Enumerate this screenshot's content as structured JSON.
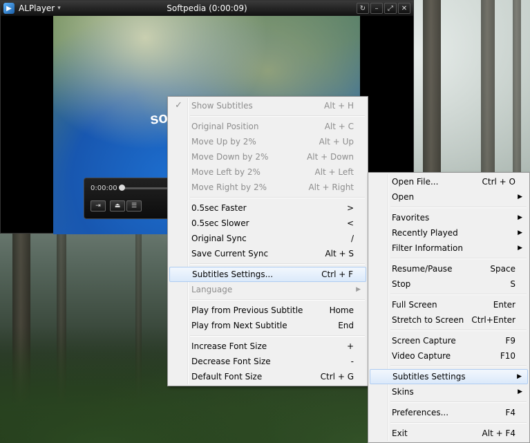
{
  "player": {
    "app_name": "ALPlayer",
    "window_title": "Softpedia (0:00:09)",
    "time": "0:00:00"
  },
  "subtitle_menu": {
    "items": [
      {
        "label": "Show Subtitles",
        "key": "Alt + H",
        "disabled": true,
        "checked": true
      },
      {
        "sep": true
      },
      {
        "label": "Original Position",
        "key": "Alt + C",
        "disabled": true
      },
      {
        "label": "Move Up by 2%",
        "key": "Alt + Up",
        "disabled": true
      },
      {
        "label": "Move Down by 2%",
        "key": "Alt + Down",
        "disabled": true
      },
      {
        "label": "Move Left by 2%",
        "key": "Alt + Left",
        "disabled": true
      },
      {
        "label": "Move Right by 2%",
        "key": "Alt + Right",
        "disabled": true
      },
      {
        "sep": true
      },
      {
        "label": "0.5sec Faster",
        "key": ">"
      },
      {
        "label": "0.5sec Slower",
        "key": "<"
      },
      {
        "label": "Original Sync",
        "key": "/"
      },
      {
        "label": "Save Current Sync",
        "key": "Alt + S"
      },
      {
        "sep": true
      },
      {
        "label": "Subtitles Settings...",
        "key": "Ctrl + F",
        "highlight": true
      },
      {
        "label": "Language",
        "disabled": true,
        "submenu": true
      },
      {
        "sep": true
      },
      {
        "label": "Play from Previous Subtitle",
        "key": "Home"
      },
      {
        "label": "Play from Next Subtitle",
        "key": "End"
      },
      {
        "sep": true
      },
      {
        "label": "Increase Font Size",
        "key": "+"
      },
      {
        "label": "Decrease Font Size",
        "key": "-"
      },
      {
        "label": "Default Font Size",
        "key": "Ctrl + G"
      }
    ]
  },
  "main_menu": {
    "items": [
      {
        "label": "Open File...",
        "key": "Ctrl + O"
      },
      {
        "label": "Open",
        "submenu": true
      },
      {
        "sep": true
      },
      {
        "label": "Favorites",
        "submenu": true
      },
      {
        "label": "Recently Played",
        "submenu": true
      },
      {
        "label": "Filter Information",
        "submenu": true
      },
      {
        "sep": true
      },
      {
        "label": "Resume/Pause",
        "key": "Space"
      },
      {
        "label": "Stop",
        "key": "S"
      },
      {
        "sep": true
      },
      {
        "label": "Full Screen",
        "key": "Enter"
      },
      {
        "label": "Stretch to Screen",
        "key": "Ctrl+Enter"
      },
      {
        "sep": true
      },
      {
        "label": "Screen Capture",
        "key": "F9"
      },
      {
        "label": "Video Capture",
        "key": "F10"
      },
      {
        "sep": true
      },
      {
        "label": "Subtitles Settings",
        "submenu": true,
        "highlight": true
      },
      {
        "label": "Skins",
        "submenu": true
      },
      {
        "sep": true
      },
      {
        "label": "Preferences...",
        "key": "F4"
      },
      {
        "sep": true
      },
      {
        "label": "Exit",
        "key": "Alt + F4"
      }
    ]
  },
  "icons": {
    "check": "✓",
    "submenu_arrow": "▶"
  },
  "colors": {
    "menu_bg": "#f0f0f0",
    "highlight_border": "#aeccf1",
    "disabled_text": "#8d8d8d"
  }
}
